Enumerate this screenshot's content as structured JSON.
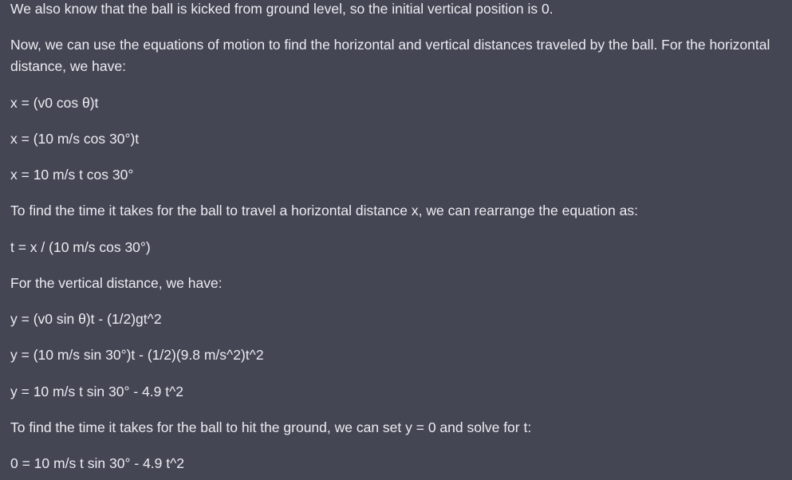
{
  "message": {
    "paragraphs": [
      "We also know that the ball is kicked from ground level, so the initial vertical position is 0.",
      "Now, we can use the equations of motion to find the horizontal and vertical distances traveled by the ball. For the horizontal distance, we have:",
      "x = (v0 cos θ)t",
      "x = (10 m/s cos 30°)t",
      "x = 10 m/s t cos 30°",
      "To find the time it takes for the ball to travel a horizontal distance x, we can rearrange the equation as:",
      "t = x / (10 m/s cos 30°)",
      "For the vertical distance, we have:",
      "y = (v0 sin θ)t - (1/2)gt^2",
      "y = (10 m/s sin 30°)t - (1/2)(9.8 m/s^2)t^2",
      "y = 10 m/s t sin 30° - 4.9 t^2",
      "To find the time it takes for the ball to hit the ground, we can set y = 0 and solve for t:",
      "0 = 10 m/s t sin 30° - 4.9 t^2"
    ]
  }
}
